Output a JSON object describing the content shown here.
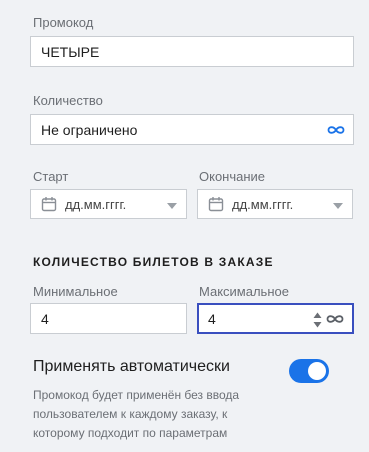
{
  "promo": {
    "label": "Промокод",
    "value": "ЧЕТЫРЕ"
  },
  "quantity": {
    "label": "Количество",
    "value": "Не ограничено"
  },
  "start": {
    "label": "Старт",
    "value": "дд.мм.гггг."
  },
  "end": {
    "label": "Окончание",
    "value": "дд.мм.гггг."
  },
  "tickets": {
    "title": "КОЛИЧЕСТВО БИЛЕТОВ В ЗАКАЗЕ",
    "min_label": "Минимальное",
    "min_value": "4",
    "max_label": "Максимальное",
    "max_value": "4"
  },
  "auto": {
    "title": "Применять автоматически",
    "enabled": true,
    "description": "Промокод будет применён без ввода пользователем к каждому заказу, к которому подходит по параметрам"
  },
  "colors": {
    "accent": "#1a73e8",
    "focus_border": "#3a4fbf"
  }
}
